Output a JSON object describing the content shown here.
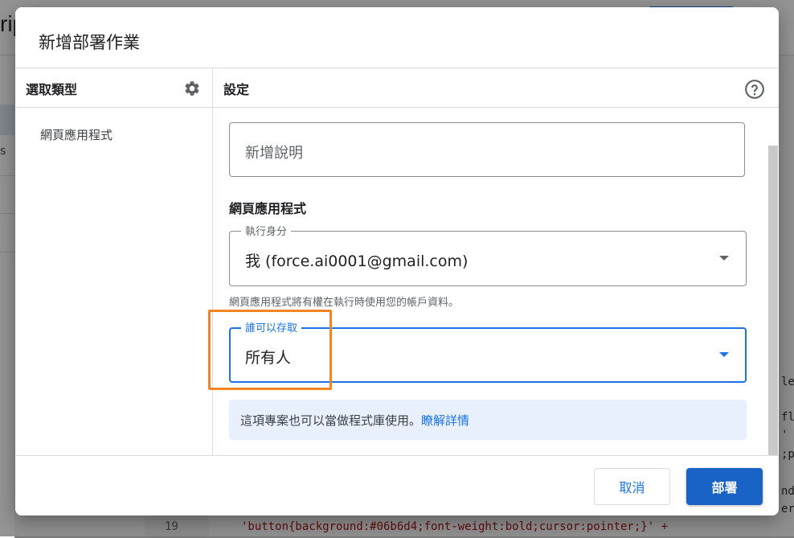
{
  "background": {
    "app_title_fragment": "rip",
    "sidebar_fragment": "s",
    "code_line_number": "19",
    "code_line": "'button{background:#06b6d4;font-weight:bold;cursor:pointer;}' +",
    "right_code_fragments": [
      "le",
      "fl",
      "'",
      ";p",
      "nd",
      "er"
    ]
  },
  "dialog": {
    "title": "新增部署作業",
    "left_panel": {
      "heading": "選取類型",
      "items": [
        "網頁應用程式"
      ]
    },
    "right_panel": {
      "heading": "設定",
      "description_placeholder": "新增說明",
      "section_title": "網頁應用程式",
      "execute_as": {
        "label": "執行身分",
        "value": "我 (force.ai0001@gmail.com)"
      },
      "execute_helper": "網頁應用程式將有權在執行時使用您的帳戶資料。",
      "who_has_access": {
        "label": "誰可以存取",
        "value": "所有人"
      },
      "info": {
        "text": "這項專案也可以當做程式庫使用。",
        "link": "瞭解詳情"
      }
    },
    "buttons": {
      "cancel": "取消",
      "deploy": "部署"
    }
  },
  "colors": {
    "accent": "#1a73e8",
    "highlight": "#f28522",
    "info_bg": "#e8f0fe"
  }
}
